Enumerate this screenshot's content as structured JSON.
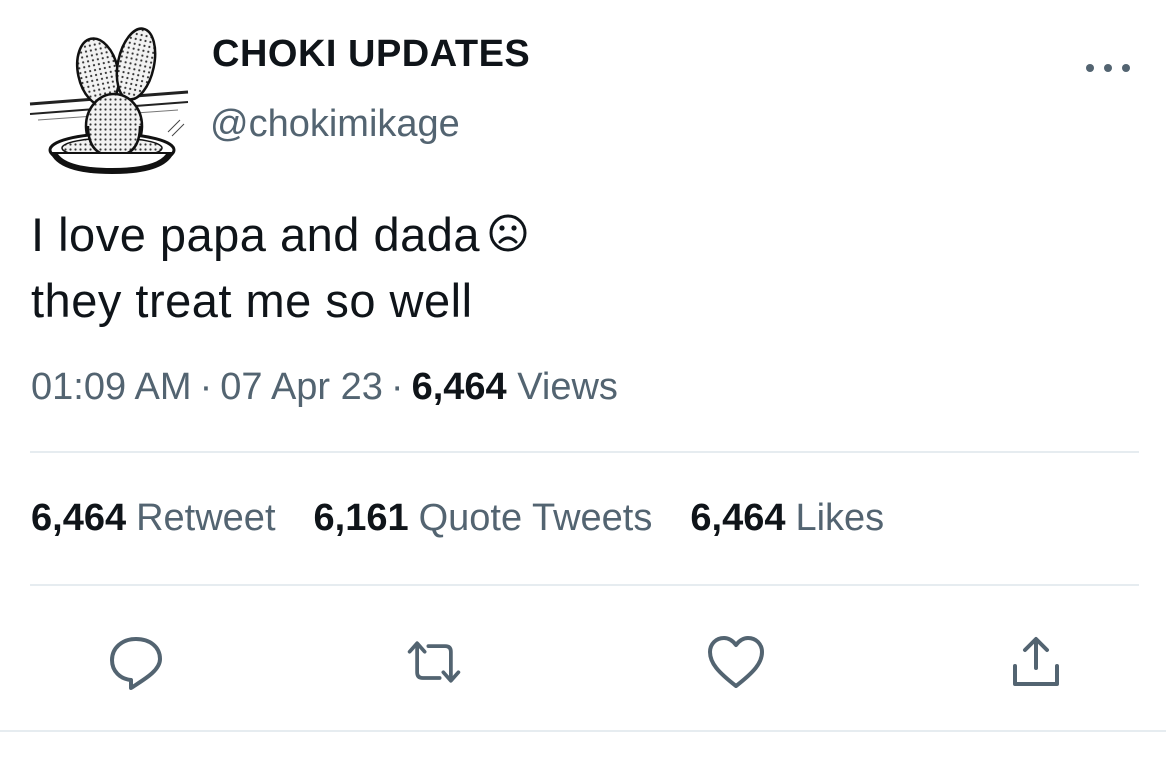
{
  "user": {
    "display_name": "CHOKI UPDATES",
    "handle": "@chokimikage",
    "avatar_icon": "cactus-avatar"
  },
  "tweet": {
    "lines": [
      "I love papa and dada",
      "they treat me so well"
    ],
    "emoji": "frowning-face-icon"
  },
  "meta": {
    "time": "01:09 AM",
    "separator": "·",
    "date": "07 Apr 23",
    "views_count": "6,464",
    "views_label": "Views"
  },
  "stats": {
    "retweets_count": "6,464",
    "retweets_label": "Retweet",
    "quotes_count": "6,161",
    "quotes_label": "Quote Tweets",
    "likes_count": "6,464",
    "likes_label": "Likes"
  },
  "actions": [
    "reply-icon",
    "retweet-icon",
    "like-icon",
    "share-icon"
  ],
  "colors": {
    "text": "#0f1419",
    "secondary": "#536471",
    "divider": "#e6ecf0",
    "icon": "#536471"
  }
}
